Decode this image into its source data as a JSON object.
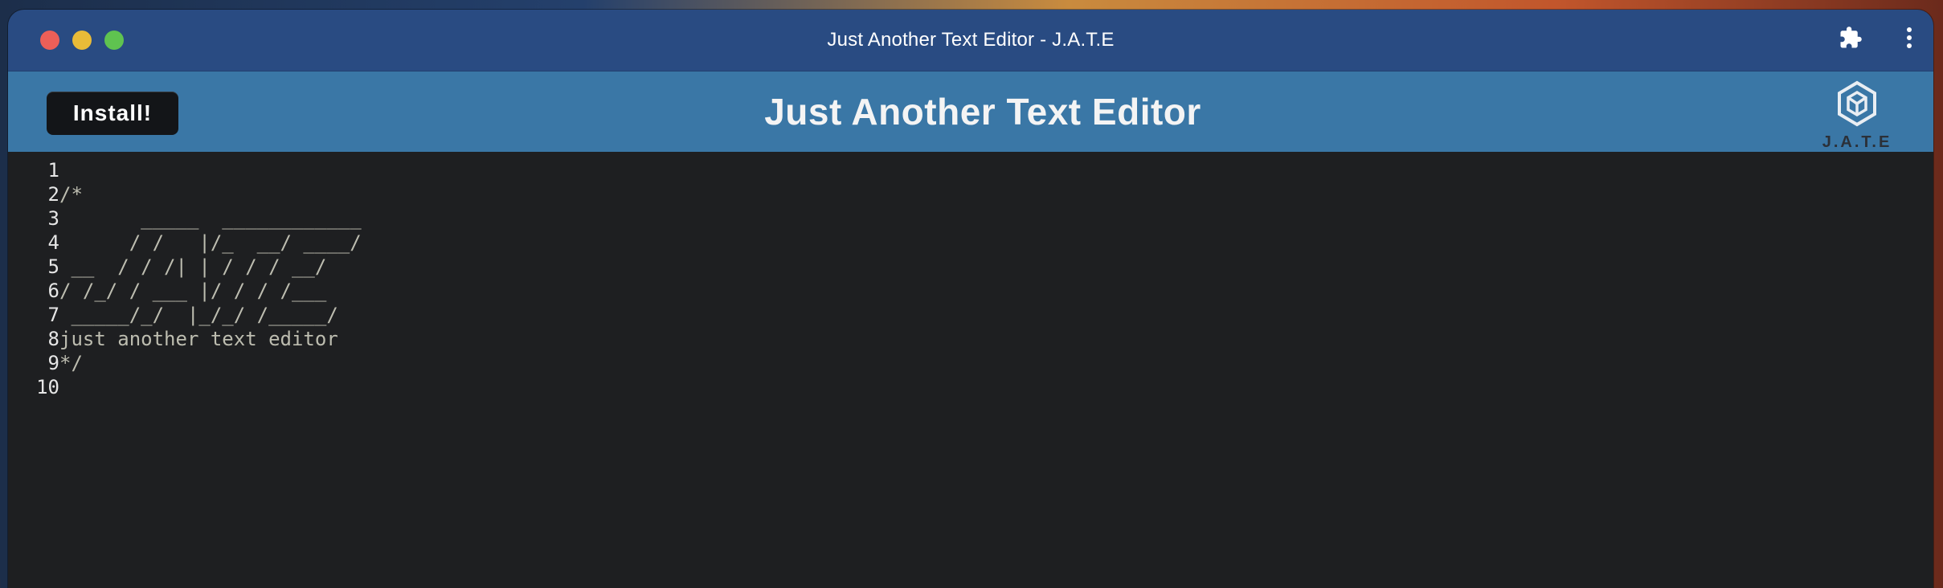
{
  "window": {
    "title": "Just Another Text Editor - J.A.T.E"
  },
  "toolbar": {
    "extensions_icon": "puzzle-piece-icon",
    "menu_icon": "kebab-menu-icon"
  },
  "header": {
    "install_label": "Install!",
    "title": "Just Another Text Editor",
    "logo_text": "J.A.T.E"
  },
  "editor": {
    "lines": [
      {
        "number": "1",
        "text": ""
      },
      {
        "number": "2",
        "text": "/*"
      },
      {
        "number": "3",
        "text": "       _____  ____________"
      },
      {
        "number": "4",
        "text": "      / /   |/_  __/ ____/"
      },
      {
        "number": "5",
        "text": " __  / / /| | / / / __/"
      },
      {
        "number": "6",
        "text": "/ /_/ / ___ |/ / / /___"
      },
      {
        "number": "7",
        "text": " _____/_/  |_/_/ /_____/"
      },
      {
        "number": "8",
        "text": "just another text editor"
      },
      {
        "number": "9",
        "text": "*/"
      },
      {
        "number": "10",
        "text": ""
      }
    ]
  },
  "colors": {
    "titlebar": "#294b82",
    "header": "#3a77a6",
    "editor_bg": "#1e1f21",
    "code_text": "#bdbdb0"
  }
}
